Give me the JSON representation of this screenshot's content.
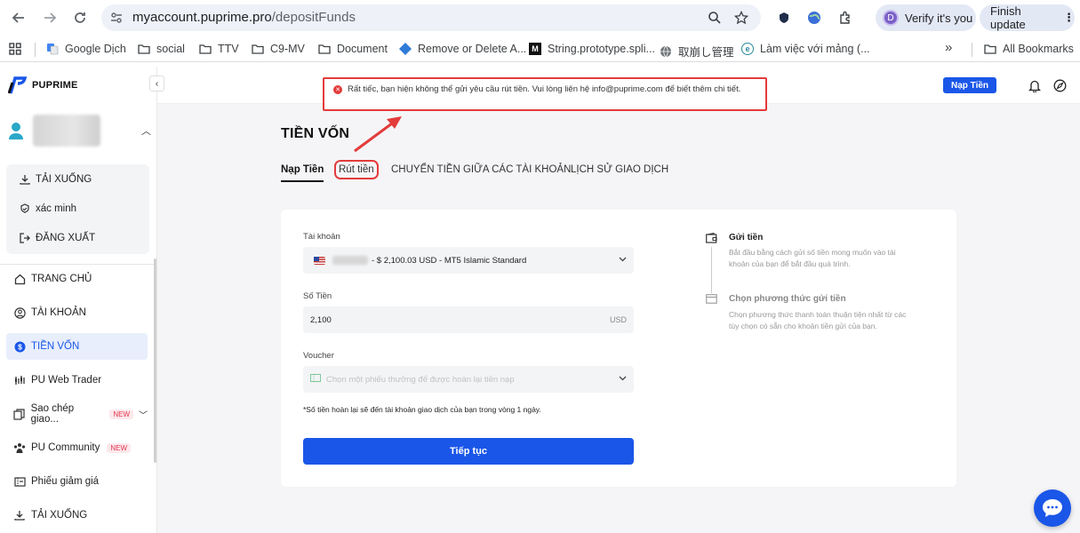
{
  "browser": {
    "url_host": "myaccount.puprime.pro",
    "url_path": "/depositFunds",
    "verify_label": "Verify it's you",
    "verify_initial": "D",
    "finish_update_label": "Finish update",
    "bookmarks": [
      {
        "label": "Google Dịch",
        "icon": "translate-icon"
      },
      {
        "label": "social",
        "icon": "folder-icon"
      },
      {
        "label": "TTV",
        "icon": "folder-icon"
      },
      {
        "label": "C9-MV",
        "icon": "folder-icon"
      },
      {
        "label": "Document",
        "icon": "folder-icon"
      },
      {
        "label": "Remove or Delete A...",
        "icon": "diamond-icon"
      },
      {
        "label": "String.prototype.spli...",
        "icon": "mdn-icon"
      },
      {
        "label": "取崩し管理",
        "icon": "globe-icon"
      },
      {
        "label": "Làm việc với mảng (...",
        "icon": "e-icon"
      }
    ],
    "all_bookmarks_label": "All Bookmarks",
    "overflow_label": "»"
  },
  "sidebar": {
    "logo_text": "PUPRIME",
    "user_menu": [
      {
        "label": "TẢI XUỐNG",
        "icon": "download-icon"
      },
      {
        "label": "xác minh",
        "icon": "shield-icon"
      },
      {
        "label": "ĐĂNG XUẤT",
        "icon": "logout-icon"
      }
    ],
    "nav": [
      {
        "label": "TRANG CHỦ",
        "icon": "home-icon"
      },
      {
        "label": "TÀI KHOẢN",
        "icon": "user-icon"
      },
      {
        "label": "TIỀN VỐN",
        "icon": "dollar-icon"
      },
      {
        "label": "PU Web Trader",
        "icon": "chart-icon"
      },
      {
        "label": "Sao chép giao...",
        "icon": "copy-icon",
        "badge": "NEW"
      },
      {
        "label": "PU Community",
        "icon": "community-icon",
        "badge": "NEW"
      },
      {
        "label": "Phiếu giảm giá",
        "icon": "coupon-icon"
      },
      {
        "label": "TẢI XUỐNG",
        "icon": "download-icon"
      }
    ]
  },
  "topbar": {
    "deposit_label": "Nạp Tiền",
    "error_message": "Rất tiếc, bạn hiện không thể gửi yêu cầu rút tiền. Vui lòng liên hệ info@puprime.com để biết thêm chi tiết."
  },
  "page": {
    "title": "TIỀN VỐN",
    "tabs": [
      "Nạp Tiền",
      "Rút tiền",
      "CHUYỂN TIỀN GIỮA CÁC TÀI KHOẢN",
      "LỊCH SỬ GIAO DỊCH"
    ]
  },
  "form": {
    "account_label": "Tài khoản",
    "account_value": "- $ 2,100.03 USD - MT5 Islamic Standard",
    "amount_label": "Số Tiền",
    "amount_value": "2,100",
    "amount_unit": "USD",
    "voucher_label": "Voucher",
    "voucher_placeholder": "Chọn một phiếu thưởng để được hoàn lại tiền nạp",
    "note": "*Số tiền hoàn lại sẽ đến tài khoản giao dịch của bạn trong vòng 1 ngày.",
    "continue_label": "Tiếp tục"
  },
  "steps": [
    {
      "title": "Gửi tiền",
      "desc": "Bắt đầu bằng cách gửi số tiền mong muốn vào tài khoản của bạn để bắt đầu quá trình."
    },
    {
      "title": "Chọn phương thức gửi tiền",
      "desc": "Chọn phương thức thanh toán thuận tiện nhất từ các tùy chọn có sẵn cho khoản tiền gửi của bạn."
    }
  ],
  "colors": {
    "accent": "#1a56e8",
    "error": "#e33b3b"
  }
}
